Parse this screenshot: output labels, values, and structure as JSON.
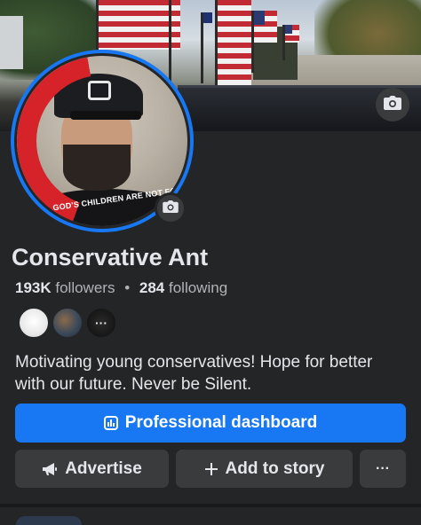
{
  "profile": {
    "name": "Conservative Ant",
    "followers_count": "193K",
    "followers_label": "followers",
    "separator": "•",
    "following_count": "284",
    "following_label": "following",
    "bio": "Motivating young conservatives! Hope for better with our future. Never be Silent.",
    "avatar_frame_text": "GOD'S CHILDREN ARE NOT FOR SALE"
  },
  "actions": {
    "dashboard_label": "Professional dashboard",
    "advertise_label": "Advertise",
    "add_story_label": "Add to story",
    "more_label": "···"
  },
  "icons": {
    "cover_camera": "camera-icon",
    "avatar_camera": "camera-icon",
    "dashboard": "bar-chart-icon",
    "advertise": "megaphone-icon",
    "add_story": "plus-icon"
  },
  "colors": {
    "background": "#242526",
    "primary": "#1877f2",
    "secondary_button": "#3a3b3c",
    "text": "#e4e6eb",
    "muted_text": "#b0b3b8"
  }
}
